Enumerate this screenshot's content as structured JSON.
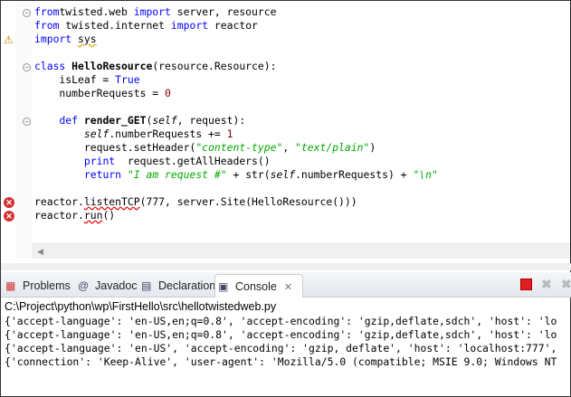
{
  "editor": {
    "lines": [
      {
        "marker": "",
        "fold": false,
        "tokens": [
          [
            "str",
            "'''"
          ]
        ]
      },
      {
        "marker": "",
        "fold": true,
        "tokens": [
          [
            "kw",
            "from"
          ],
          [
            "",
            "twisted.web "
          ],
          [
            "kw",
            "import"
          ],
          [
            "",
            " server, resource"
          ]
        ]
      },
      {
        "marker": "",
        "fold": false,
        "tokens": [
          [
            "kw",
            "from"
          ],
          [
            "",
            " twisted.internet "
          ],
          [
            "kw",
            "import"
          ],
          [
            "",
            " reactor"
          ]
        ]
      },
      {
        "marker": "warning",
        "fold": false,
        "tokens": [
          [
            "kw",
            "import"
          ],
          [
            "",
            " "
          ],
          [
            "warnu",
            "sys"
          ]
        ]
      },
      {
        "marker": "",
        "fold": false,
        "tokens": []
      },
      {
        "marker": "",
        "fold": true,
        "tokens": [
          [
            "kw",
            "class"
          ],
          [
            "",
            " "
          ],
          [
            "bold",
            "HelloResource"
          ],
          [
            "",
            "(resource.Resource):"
          ]
        ]
      },
      {
        "marker": "",
        "fold": false,
        "tokens": [
          [
            "",
            "    isLeaf = "
          ],
          [
            "kw",
            "True"
          ]
        ]
      },
      {
        "marker": "",
        "fold": false,
        "tokens": [
          [
            "",
            "    numberRequests = "
          ],
          [
            "num",
            "0"
          ]
        ]
      },
      {
        "marker": "",
        "fold": false,
        "tokens": []
      },
      {
        "marker": "",
        "fold": true,
        "tokens": [
          [
            "",
            "    "
          ],
          [
            "kw",
            "def"
          ],
          [
            "",
            " "
          ],
          [
            "bold",
            "render_GET"
          ],
          [
            "",
            "("
          ],
          [
            "self",
            "self"
          ],
          [
            "",
            ", request):"
          ]
        ]
      },
      {
        "marker": "",
        "fold": false,
        "tokens": [
          [
            "",
            "        "
          ],
          [
            "self",
            "self"
          ],
          [
            "",
            ".numberRequests += "
          ],
          [
            "num",
            "1"
          ]
        ]
      },
      {
        "marker": "",
        "fold": false,
        "tokens": [
          [
            "",
            "        request.setHeader("
          ],
          [
            "str",
            "\"content-type\""
          ],
          [
            "",
            ", "
          ],
          [
            "str",
            "\"text/plain\""
          ],
          [
            "",
            ")"
          ]
        ]
      },
      {
        "marker": "",
        "fold": false,
        "tokens": [
          [
            "",
            "        "
          ],
          [
            "kw",
            "print"
          ],
          [
            "",
            "  request.getAllHeaders()"
          ]
        ]
      },
      {
        "marker": "",
        "fold": false,
        "tokens": [
          [
            "",
            "        "
          ],
          [
            "kw",
            "return"
          ],
          [
            "",
            " "
          ],
          [
            "str",
            "\"I am request #\""
          ],
          [
            "",
            " + str("
          ],
          [
            "self",
            "self"
          ],
          [
            "",
            ".numberRequests) + "
          ],
          [
            "str",
            "\"\\n\""
          ]
        ]
      },
      {
        "marker": "",
        "fold": false,
        "tokens": []
      },
      {
        "marker": "error",
        "fold": false,
        "tokens": [
          [
            "",
            "reactor."
          ],
          [
            "erru",
            "listenTCP"
          ],
          [
            "",
            "(777, server.Site(HelloResource()))"
          ]
        ]
      },
      {
        "marker": "error",
        "fold": false,
        "tokens": [
          [
            "",
            "reactor."
          ],
          [
            "erru",
            "run"
          ],
          [
            "",
            "()"
          ]
        ]
      }
    ]
  },
  "panel": {
    "tabs": [
      {
        "label": "Problems",
        "icon": "problems-icon",
        "glyph": "▦",
        "active": false
      },
      {
        "label": "Javadoc",
        "icon": "at-icon",
        "glyph": "@",
        "active": false
      },
      {
        "label": "Declaration",
        "icon": "declaration-icon",
        "glyph": "▤",
        "active": false
      },
      {
        "label": "Console",
        "icon": "console-icon",
        "glyph": "▣",
        "active": true
      }
    ],
    "close_glyph": "✕",
    "path": "C:\\Project\\python\\wp\\FirstHello\\src\\hellotwistedweb.py",
    "console_lines": [
      "{'accept-language': 'en-US,en;q=0.8', 'accept-encoding': 'gzip,deflate,sdch', 'host': 'lo",
      "{'accept-language': 'en-US,en;q=0.8', 'accept-encoding': 'gzip,deflate,sdch', 'host': 'lo",
      "{'accept-language': 'en-US', 'accept-encoding': 'gzip, deflate', 'host': 'localhost:777',",
      "{'connection': 'Keep-Alive', 'user-agent': 'Mozilla/5.0 (compatible; MSIE 9.0; Windows NT"
    ],
    "colors": {
      "terminate": "#e02020"
    }
  }
}
